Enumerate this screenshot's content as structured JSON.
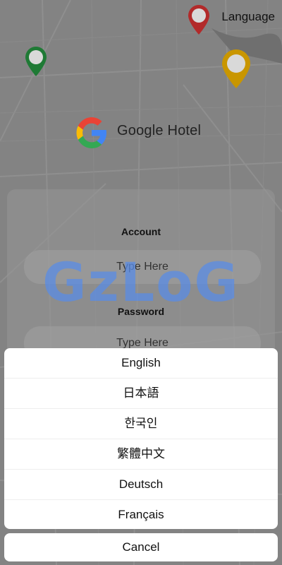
{
  "header": {
    "language_label": "Language"
  },
  "brand": {
    "name": "Google Hotel",
    "colors": {
      "blue": "#4285F4",
      "red": "#EA4335",
      "yellow": "#FBBC05",
      "green": "#34A853"
    }
  },
  "pins": {
    "colors": [
      "#b22a2a",
      "#1f7a35",
      "#c99600"
    ]
  },
  "form": {
    "account_label": "Account",
    "account_placeholder": "Type Here",
    "password_label": "Password",
    "password_placeholder": "Type Here"
  },
  "watermark": "GzLoG",
  "language_sheet": {
    "options": [
      "English",
      "日本語",
      "한국인",
      "繁體中文",
      "Deutsch",
      "Français"
    ],
    "cancel_label": "Cancel"
  }
}
